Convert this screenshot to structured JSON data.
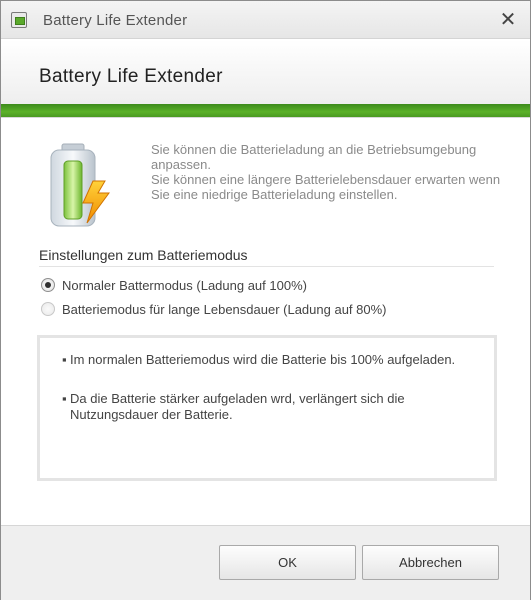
{
  "window": {
    "title": "Battery Life Extender",
    "icon": "battery-app-icon",
    "close_glyph": "✕"
  },
  "header": {
    "title": "Battery Life Extender",
    "accent_color": "#4fa326"
  },
  "intro": {
    "icon": "battery-charging-icon",
    "lines": [
      "Sie können die Batterieladung an die Betriebsumgebung anpassen.",
      "Sie können eine längere Batterielebensdauer erwarten wenn Sie eine niedrige Batterieladung einstellen."
    ]
  },
  "mode": {
    "section_label": "Einstellungen zum Batteriemodus",
    "options": [
      {
        "label": "Normaler Battermodus (Ladung auf 100%)",
        "checked": true
      },
      {
        "label": "Batteriemodus für lange Lebensdauer (Ladung auf 80%)",
        "checked": false
      }
    ]
  },
  "info": {
    "bullet_glyph": "▪",
    "bullets": [
      "Im normalen Batteriemodus wird die Batterie bis 100% aufgeladen.",
      "Da die Batterie stärker aufgeladen wrd, verlängert sich die Nutzungsdauer der Batterie."
    ]
  },
  "buttons": {
    "ok": "OK",
    "cancel": "Abbrechen"
  }
}
